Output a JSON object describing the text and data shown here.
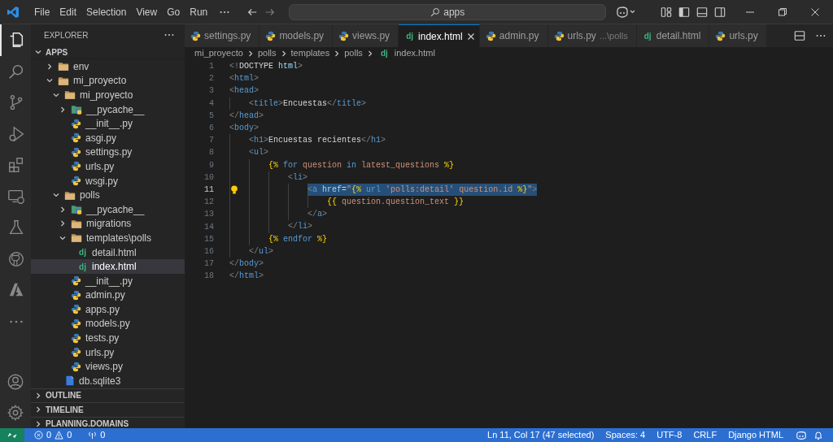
{
  "title_bar": {
    "menu": [
      "File",
      "Edit",
      "Selection",
      "View",
      "Go",
      "Run"
    ],
    "search": "apps"
  },
  "activity_bar": [
    {
      "kind": "files",
      "selected": true
    },
    {
      "kind": "search",
      "selected": false
    },
    {
      "kind": "source-control",
      "selected": false
    },
    {
      "kind": "run-debug",
      "selected": false
    },
    {
      "kind": "extensions",
      "selected": false
    },
    {
      "kind": "remote",
      "selected": false
    },
    {
      "kind": "testing",
      "selected": false
    },
    {
      "kind": "github",
      "selected": false
    },
    {
      "kind": "azure",
      "selected": false
    },
    {
      "kind": "more",
      "selected": false
    }
  ],
  "sidebar": {
    "title": "EXPLORER",
    "root": {
      "label": "APPS",
      "expanded": true,
      "children": [
        {
          "label": "env",
          "kind": "folder",
          "expanded": false,
          "selected": false
        },
        {
          "label": "mi_proyecto",
          "kind": "folder",
          "expanded": true,
          "selected": false,
          "children": [
            {
              "label": "mi_proyecto",
              "kind": "folder",
              "expanded": true,
              "selected": false,
              "children": [
                {
                  "label": "__pycache__",
                  "kind": "pycache",
                  "expanded": false,
                  "selected": false
                },
                {
                  "label": "__init__.py",
                  "kind": "python",
                  "selected": false
                },
                {
                  "label": "asgi.py",
                  "kind": "python",
                  "selected": false
                },
                {
                  "label": "settings.py",
                  "kind": "python",
                  "selected": false
                },
                {
                  "label": "urls.py",
                  "kind": "python",
                  "selected": false
                },
                {
                  "label": "wsgi.py",
                  "kind": "python",
                  "selected": false
                }
              ]
            },
            {
              "label": "polls",
              "kind": "folder",
              "expanded": true,
              "selected": false,
              "children": [
                {
                  "label": "__pycache__",
                  "kind": "pycache",
                  "expanded": false,
                  "selected": false
                },
                {
                  "label": "migrations",
                  "kind": "folder",
                  "expanded": false,
                  "selected": false
                },
                {
                  "label": "templates\\polls",
                  "kind": "folder",
                  "expanded": true,
                  "selected": false,
                  "children": [
                    {
                      "label": "detail.html",
                      "kind": "django",
                      "icon_text": "dj",
                      "selected": false
                    },
                    {
                      "label": "index.html",
                      "kind": "django",
                      "icon_text": "dj",
                      "selected": true
                    }
                  ]
                },
                {
                  "label": "__init__.py",
                  "kind": "python",
                  "selected": false
                },
                {
                  "label": "admin.py",
                  "kind": "python",
                  "selected": false
                },
                {
                  "label": "apps.py",
                  "kind": "python",
                  "selected": false
                },
                {
                  "label": "models.py",
                  "kind": "python",
                  "selected": false
                },
                {
                  "label": "tests.py",
                  "kind": "python",
                  "selected": false
                },
                {
                  "label": "urls.py",
                  "kind": "python",
                  "selected": false
                },
                {
                  "label": "views.py",
                  "kind": "python",
                  "selected": false
                }
              ]
            },
            {
              "label": "db.sqlite3",
              "kind": "database",
              "selected": false
            }
          ]
        }
      ]
    },
    "sections": [
      {
        "label": "OUTLINE",
        "expanded": false
      },
      {
        "label": "TIMELINE",
        "expanded": false
      },
      {
        "label": "PLANNING.DOMAINS",
        "expanded": false
      }
    ]
  },
  "tabs": [
    {
      "label": "settings.py",
      "kind": "python",
      "selected": false
    },
    {
      "label": "models.py",
      "kind": "python",
      "selected": false
    },
    {
      "label": "views.py",
      "kind": "python",
      "selected": false
    },
    {
      "label": "index.html",
      "kind": "django",
      "icon_text": "dj",
      "selected": true
    },
    {
      "label": "admin.py",
      "kind": "python",
      "selected": false
    },
    {
      "label": "urls.py",
      "kind": "python",
      "hint": "...\\polls",
      "selected": false
    },
    {
      "label": "detail.html",
      "kind": "django",
      "icon_text": "dj",
      "selected": false
    },
    {
      "label": "urls.py",
      "kind": "python",
      "selected": false
    }
  ],
  "breadcrumb": [
    {
      "label": "mi_proyecto"
    },
    {
      "label": "polls"
    },
    {
      "label": "templates"
    },
    {
      "label": "polls"
    },
    {
      "label": "index.html",
      "icon_text": "dj"
    }
  ],
  "editor": {
    "lines": [
      {
        "number": "1",
        "selected": false,
        "lightbulb": false,
        "tokens": [
          {
            "text": "<!",
            "kind": "punct"
          },
          {
            "text": "DOCTYPE",
            "kind": "text"
          },
          {
            "text": " html",
            "kind": "attr"
          },
          {
            "text": ">",
            "kind": "punct"
          }
        ]
      },
      {
        "number": "2",
        "selected": false,
        "lightbulb": false,
        "tokens": [
          {
            "text": "<",
            "kind": "punct"
          },
          {
            "text": "html",
            "kind": "tag"
          },
          {
            "text": ">",
            "kind": "punct"
          }
        ]
      },
      {
        "number": "3",
        "selected": false,
        "lightbulb": false,
        "tokens": [
          {
            "text": "<",
            "kind": "punct"
          },
          {
            "text": "head",
            "kind": "tag"
          },
          {
            "text": ">",
            "kind": "punct"
          }
        ]
      },
      {
        "number": "4",
        "selected": false,
        "lightbulb": false,
        "tokens": [
          {
            "text": "    <",
            "kind": "punct"
          },
          {
            "text": "title",
            "kind": "tag"
          },
          {
            "text": ">",
            "kind": "punct"
          },
          {
            "text": "Encuestas",
            "kind": "text"
          },
          {
            "text": "</",
            "kind": "punct"
          },
          {
            "text": "title",
            "kind": "tag"
          },
          {
            "text": ">",
            "kind": "punct"
          }
        ]
      },
      {
        "number": "5",
        "selected": false,
        "lightbulb": false,
        "tokens": [
          {
            "text": "</",
            "kind": "punct"
          },
          {
            "text": "head",
            "kind": "tag"
          },
          {
            "text": ">",
            "kind": "punct"
          }
        ]
      },
      {
        "number": "6",
        "selected": false,
        "lightbulb": false,
        "tokens": [
          {
            "text": "<",
            "kind": "punct"
          },
          {
            "text": "body",
            "kind": "tag"
          },
          {
            "text": ">",
            "kind": "punct"
          }
        ]
      },
      {
        "number": "7",
        "selected": false,
        "lightbulb": false,
        "tokens": [
          {
            "text": "    <",
            "kind": "punct"
          },
          {
            "text": "h1",
            "kind": "tag"
          },
          {
            "text": ">",
            "kind": "punct"
          },
          {
            "text": "Encuestas recientes",
            "kind": "text"
          },
          {
            "text": "</",
            "kind": "punct"
          },
          {
            "text": "h1",
            "kind": "tag"
          },
          {
            "text": ">",
            "kind": "punct"
          }
        ]
      },
      {
        "number": "8",
        "selected": false,
        "lightbulb": false,
        "tokens": [
          {
            "text": "    <",
            "kind": "punct"
          },
          {
            "text": "ul",
            "kind": "tag"
          },
          {
            "text": ">",
            "kind": "punct"
          }
        ]
      },
      {
        "number": "9",
        "selected": false,
        "lightbulb": false,
        "tokens": [
          {
            "text": "        {%",
            "kind": "tmpl"
          },
          {
            "text": " for",
            "kind": "keyword"
          },
          {
            "text": " question",
            "kind": "var"
          },
          {
            "text": " in",
            "kind": "keyword"
          },
          {
            "text": " latest_questions",
            "kind": "var"
          },
          {
            "text": " %}",
            "kind": "tmpl"
          }
        ]
      },
      {
        "number": "10",
        "selected": false,
        "lightbulb": false,
        "tokens": [
          {
            "text": "            <",
            "kind": "punct"
          },
          {
            "text": "li",
            "kind": "tag"
          },
          {
            "text": ">",
            "kind": "punct"
          }
        ]
      },
      {
        "number": "11",
        "selected": true,
        "lightbulb": true,
        "tokens": [
          {
            "text": "                <",
            "kind": "punct"
          },
          {
            "text": "a",
            "kind": "tag"
          },
          {
            "text": " href",
            "kind": "attr"
          },
          {
            "text": "=",
            "kind": "text"
          },
          {
            "text": "\"",
            "kind": "string"
          },
          {
            "text": "{%",
            "kind": "tmpl"
          },
          {
            "text": " url",
            "kind": "keyword"
          },
          {
            "text": " 'polls:detail'",
            "kind": "string"
          },
          {
            "text": " question.id",
            "kind": "var"
          },
          {
            "text": " %}",
            "kind": "tmpl"
          },
          {
            "text": "\"",
            "kind": "string"
          },
          {
            "text": ">",
            "kind": "punct"
          }
        ]
      },
      {
        "number": "12",
        "selected": false,
        "lightbulb": false,
        "tokens": [
          {
            "text": "                    {{",
            "kind": "tmpl"
          },
          {
            "text": " question.question_text",
            "kind": "var"
          },
          {
            "text": " }}",
            "kind": "tmpl"
          }
        ]
      },
      {
        "number": "13",
        "selected": false,
        "lightbulb": false,
        "tokens": [
          {
            "text": "                </",
            "kind": "punct"
          },
          {
            "text": "a",
            "kind": "tag"
          },
          {
            "text": ">",
            "kind": "punct"
          }
        ]
      },
      {
        "number": "14",
        "selected": false,
        "lightbulb": false,
        "tokens": [
          {
            "text": "            </",
            "kind": "punct"
          },
          {
            "text": "li",
            "kind": "tag"
          },
          {
            "text": ">",
            "kind": "punct"
          }
        ]
      },
      {
        "number": "15",
        "selected": false,
        "lightbulb": false,
        "tokens": [
          {
            "text": "        {%",
            "kind": "tmpl"
          },
          {
            "text": " endfor",
            "kind": "keyword"
          },
          {
            "text": " %}",
            "kind": "tmpl"
          }
        ]
      },
      {
        "number": "16",
        "selected": false,
        "lightbulb": false,
        "tokens": [
          {
            "text": "    </",
            "kind": "punct"
          },
          {
            "text": "ul",
            "kind": "tag"
          },
          {
            "text": ">",
            "kind": "punct"
          }
        ]
      },
      {
        "number": "17",
        "selected": false,
        "lightbulb": false,
        "tokens": [
          {
            "text": "</",
            "kind": "punct"
          },
          {
            "text": "body",
            "kind": "tag"
          },
          {
            "text": ">",
            "kind": "punct"
          }
        ]
      },
      {
        "number": "18",
        "selected": false,
        "lightbulb": false,
        "tokens": [
          {
            "text": "</",
            "kind": "punct"
          },
          {
            "text": "html",
            "kind": "tag"
          },
          {
            "text": ">",
            "kind": "punct"
          }
        ]
      }
    ]
  },
  "status_bar": {
    "errors": "0",
    "warnings": "0",
    "ports": "0",
    "items": [
      "Ln 11, Col 17 (47 selected)",
      "Spaces: 4",
      "UTF-8",
      "CRLF",
      "Django HTML"
    ]
  }
}
